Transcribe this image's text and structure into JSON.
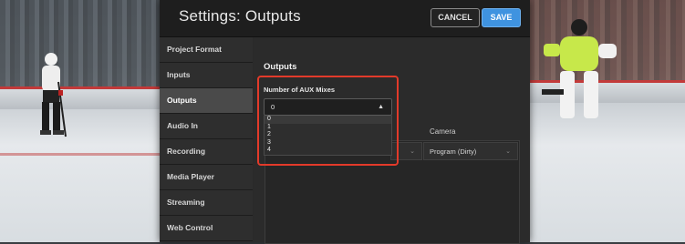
{
  "window": {
    "title": "Settings: Outputs",
    "cancel_label": "CANCEL",
    "save_label": "SAVE"
  },
  "sidebar": {
    "items": [
      {
        "label": "Project Format",
        "active": false
      },
      {
        "label": "Inputs",
        "active": false
      },
      {
        "label": "Outputs",
        "active": true
      },
      {
        "label": "Audio In",
        "active": false
      },
      {
        "label": "Recording",
        "active": false
      },
      {
        "label": "Media Player",
        "active": false
      },
      {
        "label": "Streaming",
        "active": false
      },
      {
        "label": "Web Control",
        "active": false
      }
    ]
  },
  "main": {
    "section_title": "Outputs",
    "aux": {
      "label": "Number of AUX Mixes",
      "selected": "0",
      "options": [
        "0",
        "1",
        "2",
        "3",
        "4"
      ]
    },
    "table": {
      "camera_header": "Camera",
      "camera_value": "Program (Dirty)"
    }
  },
  "colors": {
    "accent": "#3f93e0",
    "highlight": "#e23a2a"
  }
}
